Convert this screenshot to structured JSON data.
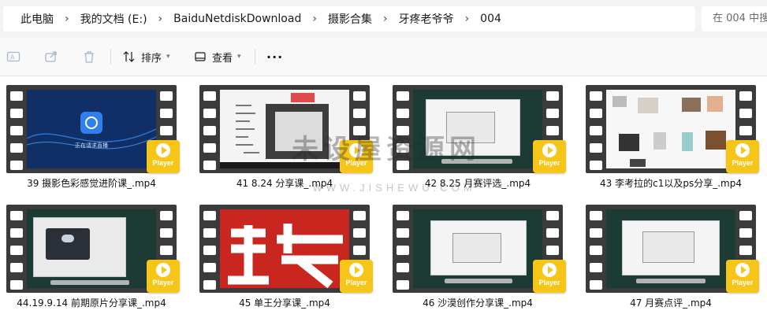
{
  "breadcrumb": {
    "items": [
      "此电脑",
      "我的文档 (E:)",
      "BaiduNetdiskDownload",
      "摄影合集",
      "牙疼老爷爷",
      "004"
    ],
    "separator": "›"
  },
  "search": {
    "placeholder": "在 004 中搜"
  },
  "toolbar": {
    "sort_label": "排序",
    "view_label": "查看",
    "more_label": "···"
  },
  "files": [
    {
      "name": "39 摄影色彩感觉进阶课_.mp4",
      "thumb": "blue-intro",
      "thumb_text": "正在请求直播"
    },
    {
      "name": "41 8.24 分享课_.mp4",
      "thumb": "mindmap"
    },
    {
      "name": "42 8.25 月赛评选_.mp4",
      "thumb": "dark-screen"
    },
    {
      "name": "43 李考拉的c1以及ps分享_.mp4",
      "thumb": "gallery"
    },
    {
      "name": "44.19.9.14 前期原片分享课_.mp4",
      "thumb": "dark-dialog"
    },
    {
      "name": "45 单王分享课_.mp4",
      "thumb": "red-logo"
    },
    {
      "name": "46 沙漠创作分享课_.mp4",
      "thumb": "dark-screen"
    },
    {
      "name": "47 月赛点评_.mp4",
      "thumb": "dark-screen"
    }
  ],
  "badge_label": "Player",
  "watermark": {
    "main": "未设屋资源网",
    "url": "WWW.JISHEWU.COM"
  },
  "colors": {
    "badge": "#f5c518",
    "film": "#3b3b3b",
    "red_thumb": "#c8261e",
    "dark_thumb": "#1c3b35"
  }
}
